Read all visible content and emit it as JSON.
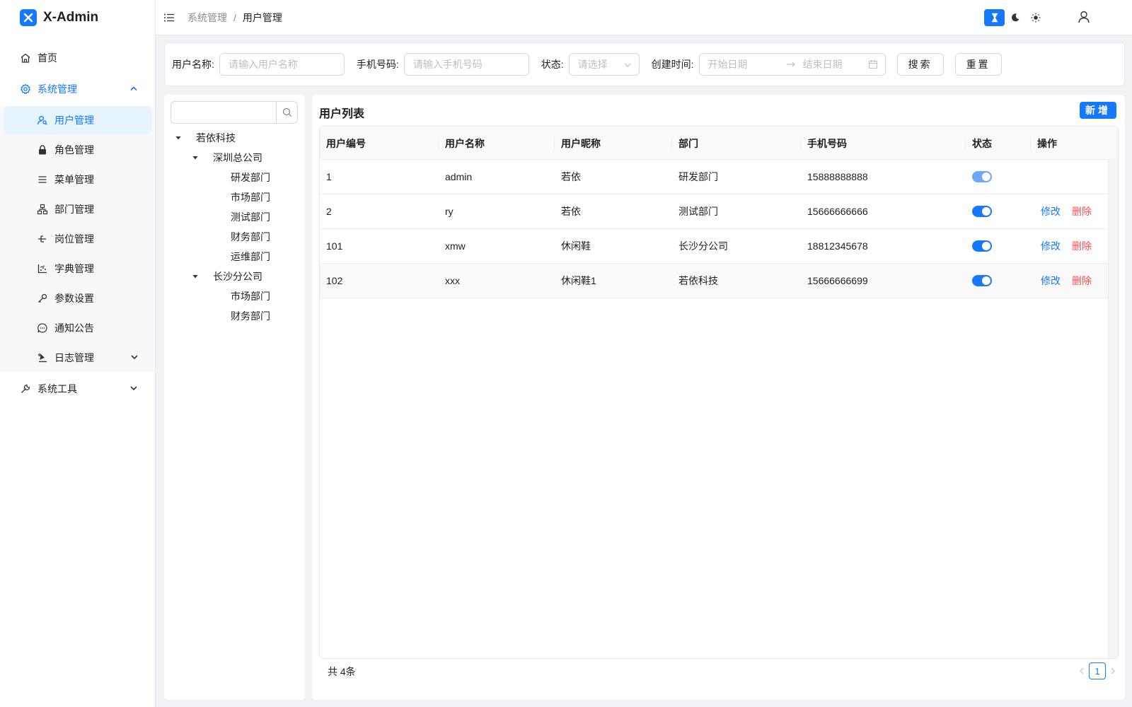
{
  "app": {
    "title": "X-Admin"
  },
  "sidebar": {
    "home": "首页",
    "system": "系统管理",
    "system_items": [
      {
        "label": "用户管理",
        "icon": "user-search-icon"
      },
      {
        "label": "角色管理",
        "icon": "lock-icon"
      },
      {
        "label": "菜单管理",
        "icon": "list-icon"
      },
      {
        "label": "部门管理",
        "icon": "org-chart-icon"
      },
      {
        "label": "岗位管理",
        "icon": "position-icon"
      },
      {
        "label": "字典管理",
        "icon": "chart-dots-icon"
      },
      {
        "label": "参数设置",
        "icon": "param-icon"
      },
      {
        "label": "通知公告",
        "icon": "chat-icon"
      },
      {
        "label": "日志管理",
        "icon": "log-icon"
      }
    ],
    "tools": "系统工具"
  },
  "header": {
    "breadcrumb_parent": "系统管理",
    "breadcrumb_sep": "/",
    "breadcrumb_current": "用户管理"
  },
  "search": {
    "username_label": "用户名称:",
    "username_placeholder": "请输入用户名称",
    "phone_label": "手机号码:",
    "phone_placeholder": "请输入手机号码",
    "status_label": "状态:",
    "status_placeholder": "请选择",
    "created_label": "创建时间:",
    "start_placeholder": "开始日期",
    "end_placeholder": "结束日期",
    "search_btn": "搜索",
    "reset_btn": "重置"
  },
  "tree": {
    "nodes": [
      {
        "label": "若依科技"
      },
      {
        "label": "深圳总公司"
      },
      {
        "label": "研发部门"
      },
      {
        "label": "市场部门"
      },
      {
        "label": "测试部门"
      },
      {
        "label": "财务部门"
      },
      {
        "label": "运维部门"
      },
      {
        "label": "长沙分公司"
      },
      {
        "label": "市场部门"
      },
      {
        "label": "财务部门"
      }
    ]
  },
  "table": {
    "title": "用户列表",
    "add_btn": "新增",
    "columns": [
      "用户编号",
      "用户名称",
      "用户昵称",
      "部门",
      "手机号码",
      "状态",
      "操作"
    ],
    "rows": [
      {
        "id": "1",
        "username": "admin",
        "nickname": "若依",
        "dept": "研发部门",
        "phone": "15888888888",
        "enabled": true
      },
      {
        "id": "2",
        "username": "ry",
        "nickname": "若依",
        "dept": "测试部门",
        "phone": "15666666666",
        "enabled": true
      },
      {
        "id": "101",
        "username": "xmw",
        "nickname": "休闲鞋",
        "dept": "长沙分公司",
        "phone": "18812345678",
        "enabled": true
      },
      {
        "id": "102",
        "username": "xxx",
        "nickname": "休闲鞋1",
        "dept": "若依科技",
        "phone": "15666666699",
        "enabled": true
      }
    ],
    "edit_label": "修改",
    "delete_label": "删除",
    "total_text": "共 4条",
    "current_page": "1"
  },
  "colors": {
    "primary": "#1677ff",
    "danger": "#ff4d4f",
    "muted": "#8c8c8c"
  }
}
